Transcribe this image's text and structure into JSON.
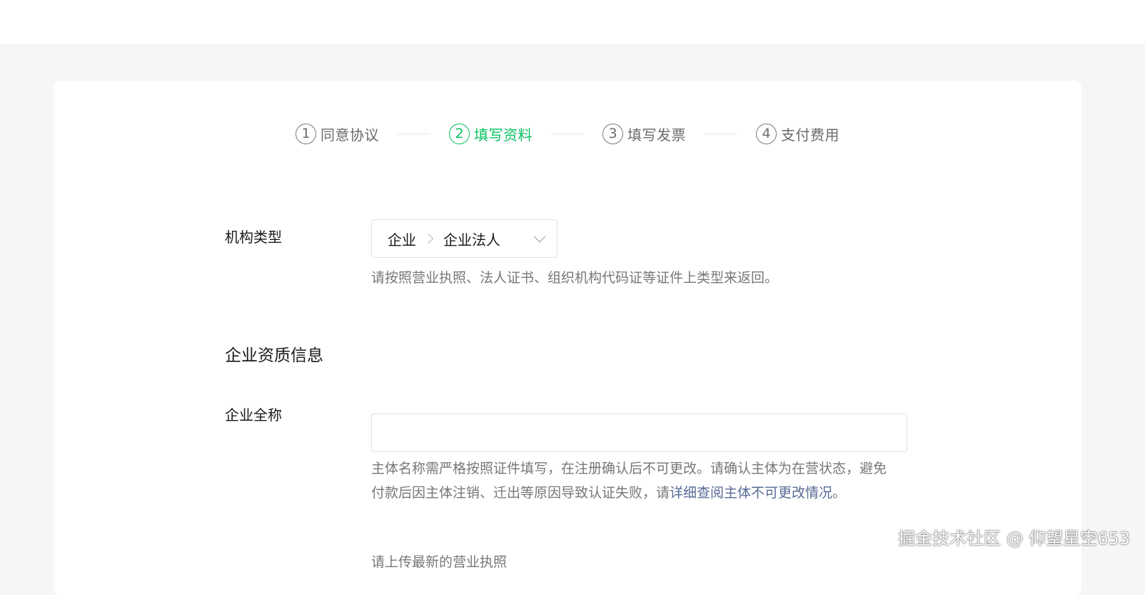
{
  "steps": [
    {
      "num": "1",
      "label": "同意协议",
      "active": false
    },
    {
      "num": "2",
      "label": "填写资料",
      "active": true
    },
    {
      "num": "3",
      "label": "填写发票",
      "active": false
    },
    {
      "num": "4",
      "label": "支付费用",
      "active": false
    }
  ],
  "org_type": {
    "label": "机构类型",
    "level1": "企业",
    "level2": "企业法人",
    "hint": "请按照营业执照、法人证书、组织机构代码证等证件上类型来返回。"
  },
  "section": {
    "title": "企业资质信息"
  },
  "company_name": {
    "label": "企业全称",
    "value": "",
    "placeholder": "",
    "hint_prefix": "主体名称需严格按照证件填写，在注册确认后不可更改。请确认主体为在营状态，避免付款后因主体注销、迁出等原因导致认证失败，请",
    "hint_link": "详细查阅主体不可更改情况",
    "hint_suffix": "。"
  },
  "next_hint": "请上传最新的营业执照",
  "watermark": "掘金技术社区 @ 仰望星空653",
  "colors": {
    "accent": "#07c160",
    "link": "#576b95"
  }
}
